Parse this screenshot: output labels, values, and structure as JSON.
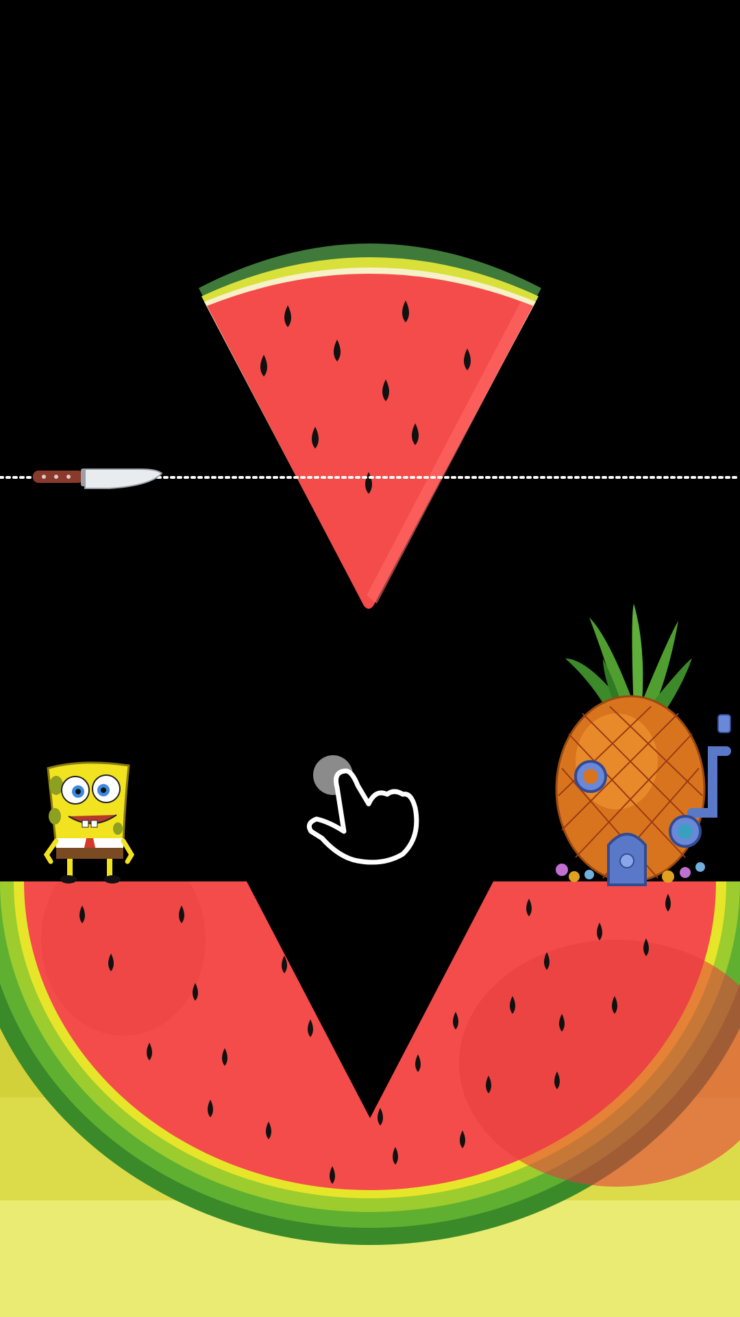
{
  "game": {
    "scene": "watermelon-slice-puzzle",
    "hint": "tap-to-cut",
    "colors": {
      "background": "#000000",
      "melon_flesh": "#f44c4a",
      "melon_flesh_shade": "#e5403e",
      "melon_seed": "#111111",
      "rind_dark_green": "#3b8a2a",
      "rind_green": "#5fb031",
      "rind_light_green": "#9ccc2e",
      "rind_yellow": "#e7e52a",
      "rind_cream": "#f6f1c8",
      "ground_band_1": "#c8c52a",
      "ground_band_2": "#d8d740",
      "ground_band_3": "#e2e255",
      "ground_band_4": "#eaeb72",
      "cut_line": "#ffffff"
    },
    "icons": {
      "knife": "knife-icon",
      "tap_hint": "tap-hand-icon",
      "player": "sponge-character",
      "goal": "pineapple-house"
    }
  }
}
